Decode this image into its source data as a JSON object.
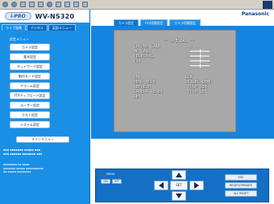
{
  "header": {
    "model": "WV-NS320",
    "brand": "Panasonic"
  },
  "left_tabs": [
    "ライブ画像",
    "デジタル",
    "英語メニュー"
  ],
  "left_menu": {
    "title": "設定メニュー",
    "items": [
      "カメラ設定",
      "基本設定",
      "ネットワーク設定",
      "動作モード設定",
      "アラーム設定",
      "FTPアップロード設定",
      "ユーザー設定",
      "ホスト設定",
      "システム設定"
    ],
    "extra": "メインメニュー"
  },
  "right_tabs": [
    "カメラ設定",
    "PTZ切替設定",
    "カメラ切替設定"
  ],
  "osd": {
    "title": "** SPECIAL **",
    "rows": [
      {
        "label": "CHROMA GAIN",
        "value": "..:..."
      },
      {
        "label": "AP GAIN",
        "value": "..:..."
      },
      {
        "label": "PEDESTAL",
        "value": "..:..."
      },
      {
        "label": "PIX",
        "value": ""
      },
      {
        "label": "",
        "value": ""
      },
      {
        "label": "DNR",
        "value": "LOW"
      },
      {
        "label": "DEMO MODE",
        "value": "SPIDER-DEMO"
      },
      {
        "label": "REFRESH",
        "value": "*PUSH SET"
      },
      {
        "label": "CAMERA RESET",
        "value": "*PUSH SET"
      },
      {
        "label": "RET",
        "value": ""
      }
    ]
  },
  "pad": {
    "label": "MENU",
    "on": "ON",
    "off": "OFF",
    "set": "SET",
    "right_buttons": [
      "ESC",
      "RESET/OPERATE",
      "ALL RESET"
    ]
  }
}
